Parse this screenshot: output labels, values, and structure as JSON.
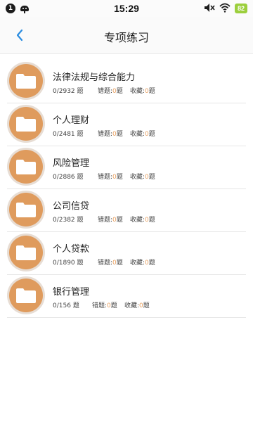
{
  "status_bar": {
    "notification_count": "1",
    "time": "15:29",
    "battery": "82"
  },
  "header": {
    "title": "专项练习"
  },
  "labels": {
    "unit": "题",
    "wrong": "错题:",
    "fav": "收藏:",
    "zero": "0"
  },
  "items": [
    {
      "title": "法律法规与综合能力",
      "progress": "0/2932"
    },
    {
      "title": "个人理财",
      "progress": "0/2481"
    },
    {
      "title": "风险管理",
      "progress": "0/2886"
    },
    {
      "title": "公司信贷",
      "progress": "0/2382"
    },
    {
      "title": "个人贷款",
      "progress": "0/1890"
    },
    {
      "title": "银行管理",
      "progress": "0/156"
    }
  ],
  "icons": {
    "folder": "folder-icon",
    "back": "chevron-left-icon"
  },
  "colors": {
    "accent": "#df9b5d",
    "back_arrow": "#2a8ce0",
    "battery": "#9ccf3d"
  }
}
